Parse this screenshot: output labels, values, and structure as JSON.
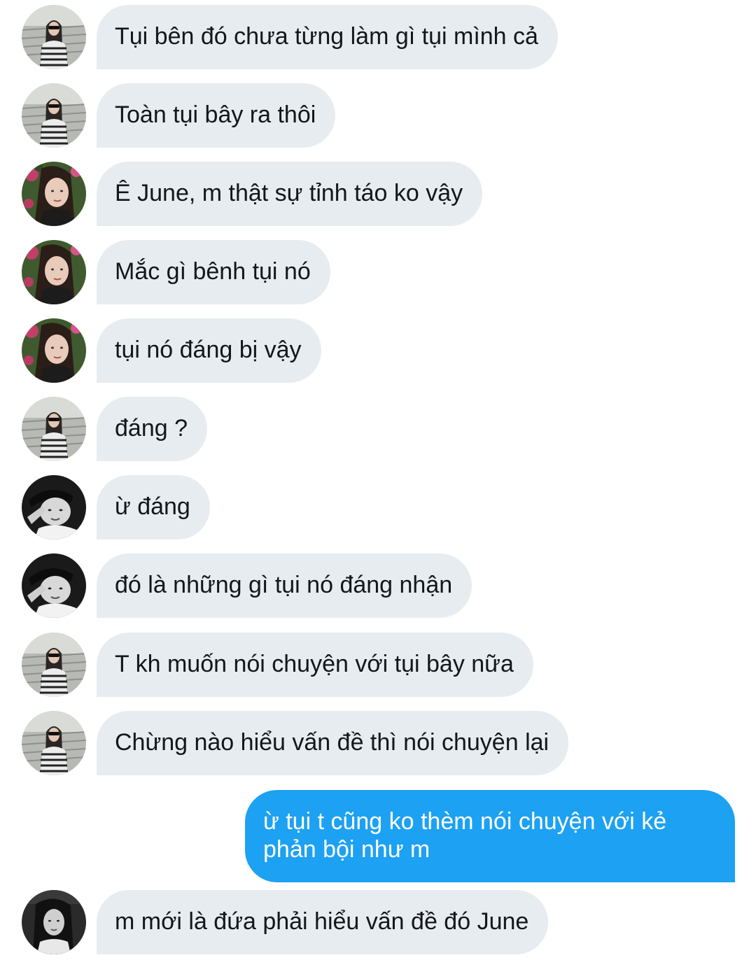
{
  "conversation": {
    "messages": [
      {
        "text": "Tụi bên đó chưa từng làm gì tụi mình cả",
        "avatar": "avatar-girl-sunglasses"
      },
      {
        "text": "Toàn tụi bây ra thôi",
        "avatar": "avatar-girl-sunglasses"
      },
      {
        "text": "Ê June, m thật sự tỉnh táo ko vậy",
        "avatar": "avatar-girl-flowers"
      },
      {
        "text": "Mắc gì bênh tụi nó",
        "avatar": "avatar-girl-flowers"
      },
      {
        "text": "tụi nó đáng bị vậy",
        "avatar": "avatar-girl-flowers"
      },
      {
        "text": "đáng ?",
        "avatar": "avatar-girl-sunglasses"
      },
      {
        "text": "ừ đáng",
        "avatar": "avatar-boy-bw"
      },
      {
        "text": "đó là những gì tụi nó đáng nhận",
        "avatar": "avatar-boy-bw"
      },
      {
        "text": "T kh muốn nói chuyện với tụi bây nữa",
        "avatar": "avatar-girl-sunglasses"
      },
      {
        "text": "Chừng nào hiểu vấn đề thì nói chuyện lại",
        "avatar": "avatar-girl-sunglasses"
      },
      {
        "text": "ừ tụi t cũng ko thèm nói chuyện với kẻ phản bội như m",
        "avatar": "",
        "sent": true
      },
      {
        "text": "m mới là đứa phải hiểu vấn đề đó June",
        "avatar": "avatar-girl-dark"
      }
    ]
  },
  "colors": {
    "received_bubble": "#e7ecf0",
    "sent_bubble": "#1da1f2",
    "text_dark": "#14171a",
    "text_light": "#ffffff"
  }
}
